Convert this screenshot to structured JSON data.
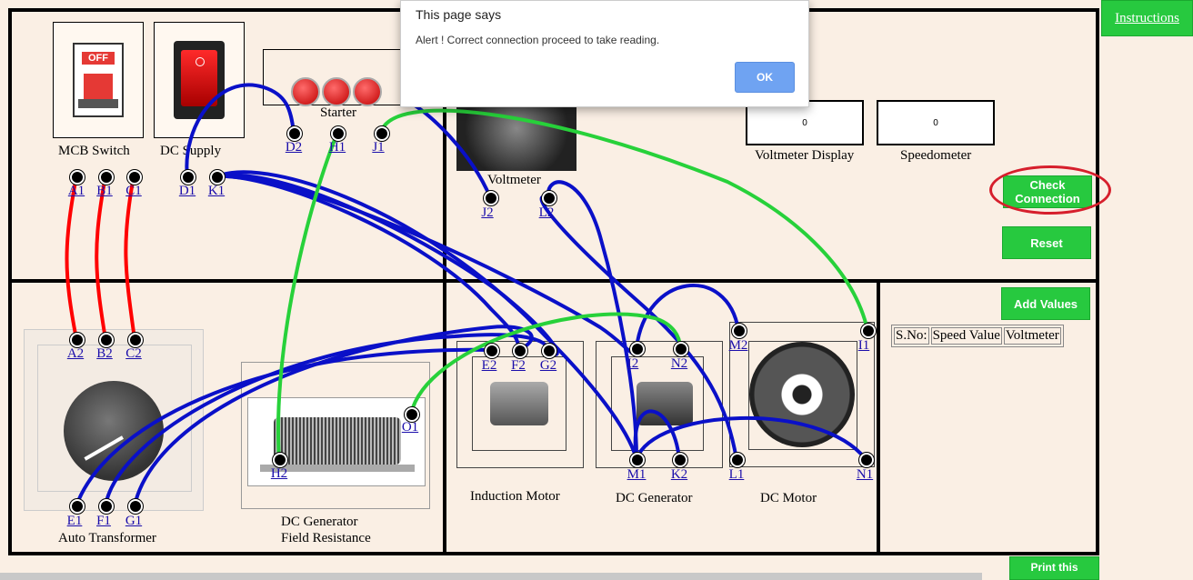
{
  "dialog": {
    "title": "This page says",
    "message": "Alert ! Correct connection proceed to take reading.",
    "ok_label": "OK"
  },
  "header": {
    "instructions_label": "Instructions"
  },
  "components": {
    "mcb_label": "MCB Switch",
    "mcb_off_text": "OFF",
    "dc_supply_label": "DC Supply",
    "starter_label": "Starter",
    "voltmeter_label": "Voltmeter",
    "voltmeter_display_label": "Voltmeter Display",
    "speedometer_label": "Speedometer",
    "auto_transformer_label": "Auto Transformer",
    "field_resistance_label_1": "DC Generator",
    "field_resistance_label_2": "Field Resistance",
    "induction_motor_label": "Induction Motor",
    "dc_generator_label": "DC Generator",
    "dc_motor_label": "DC Motor"
  },
  "displays": {
    "voltmeter_value": "0",
    "speedometer_value": "0"
  },
  "buttons": {
    "check_connection": "Check Connection",
    "reset": "Reset",
    "add_values": "Add Values",
    "print": "Print this"
  },
  "table": {
    "headers": [
      "S.No:",
      "Speed Value",
      "Voltmeter"
    ]
  },
  "terminals": {
    "A1": "A1",
    "B1": "B1",
    "C1": "C1",
    "D1": "D1",
    "K1": "K1",
    "D2": "D2",
    "H1": "H1",
    "J1": "J1",
    "J2": "J2",
    "L2": "L2",
    "A2": "A2",
    "B2": "B2",
    "C2": "C2",
    "E1": "E1",
    "F1": "F1",
    "G1": "G1",
    "H2": "H2",
    "O1": "O1",
    "E2": "E2",
    "F2": "F2",
    "G2": "G2",
    "I2": "I2",
    "N2": "N2",
    "M1": "M1",
    "K2": "K2",
    "M2": "M2",
    "I1": "I1",
    "L1": "L1",
    "N1": "N1"
  },
  "colors": {
    "wire_red": "#ff0000",
    "wire_blue": "#0a10c8",
    "wire_green": "#27d13a",
    "button_green": "#27c93f",
    "highlight": "#d61f2c"
  }
}
